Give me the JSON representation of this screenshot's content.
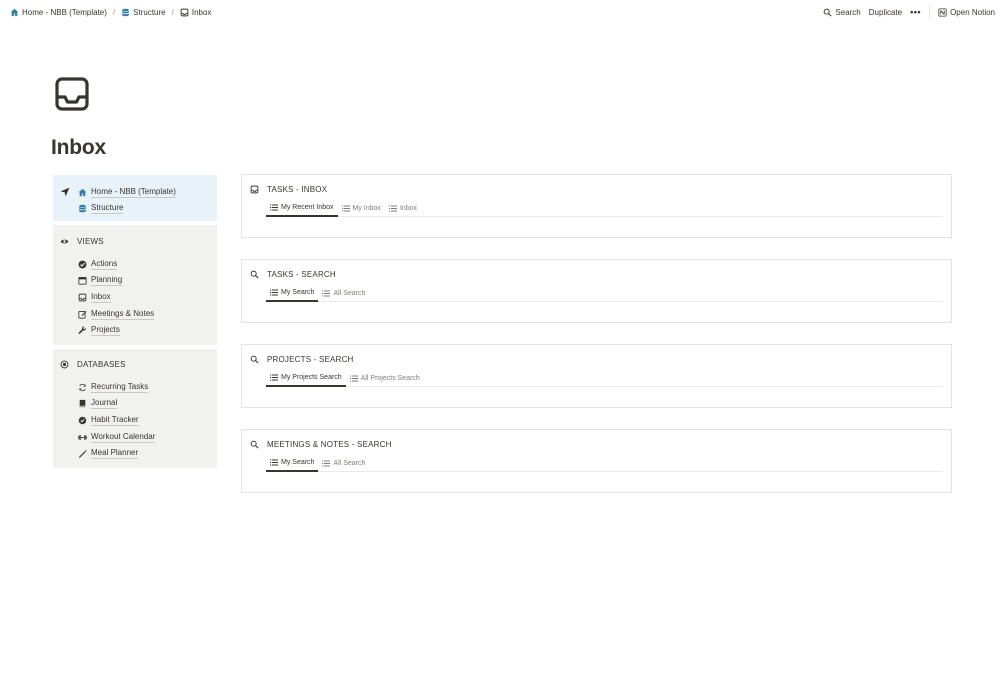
{
  "breadcrumb": [
    {
      "label": "Home - NBB (Template)",
      "icon": "home-icon"
    },
    {
      "label": "Structure",
      "icon": "database-icon"
    },
    {
      "label": "Inbox",
      "icon": "inbox-icon"
    }
  ],
  "breadcrumb_separator": "/",
  "topbar": {
    "search_label": "Search",
    "duplicate_label": "Duplicate",
    "more_label": "•••",
    "open_label": "Open Notion"
  },
  "page": {
    "title": "Inbox",
    "icon": "inbox-icon"
  },
  "nav": {
    "top_links": [
      {
        "label": "Home - NBB (Template)",
        "icon": "home-icon"
      },
      {
        "label": "Structure",
        "icon": "database-icon"
      }
    ],
    "views_heading": "VIEWS",
    "views": [
      {
        "label": "Actions",
        "icon": "check-circle-icon"
      },
      {
        "label": "Planning",
        "icon": "calendar-icon"
      },
      {
        "label": "Inbox",
        "icon": "inbox-icon"
      },
      {
        "label": "Meetings & Notes",
        "icon": "edit-icon"
      },
      {
        "label": "Projects",
        "icon": "wrench-icon"
      }
    ],
    "databases_heading": "DATABASES",
    "databases": [
      {
        "label": "Recurring Tasks",
        "icon": "refresh-icon"
      },
      {
        "label": "Journal",
        "icon": "book-icon"
      },
      {
        "label": "Habit Tracker",
        "icon": "badge-check-icon"
      },
      {
        "label": "Workout Calendar",
        "icon": "dumbbell-icon"
      },
      {
        "label": "Meal Planner",
        "icon": "utensils-icon"
      }
    ]
  },
  "panels": [
    {
      "title": "TASKS - INBOX",
      "icon": "inbox-icon",
      "tabs": [
        "My Recent Inbox",
        "My Inbox",
        "Inbox"
      ],
      "active": 0
    },
    {
      "title": "TASKS - SEARCH",
      "icon": "search-icon",
      "tabs": [
        "My Search",
        "All Search"
      ],
      "active": 0
    },
    {
      "title": "PROJECTS - SEARCH",
      "icon": "search-icon",
      "tabs": [
        "My Projects Search",
        "All Projects Search"
      ],
      "active": 0
    },
    {
      "title": "MEETINGS & NOTES - SEARCH",
      "icon": "search-icon",
      "tabs": [
        "My Search",
        "All Search"
      ],
      "active": 0
    }
  ],
  "colors": {
    "text": "#37352f",
    "muted": "#7d7c78",
    "nav_top_bg": "#e7f3f8",
    "nav_bg": "#f1f1ef",
    "border": "#e3e2e0",
    "icon_blue": "#337ea9"
  }
}
